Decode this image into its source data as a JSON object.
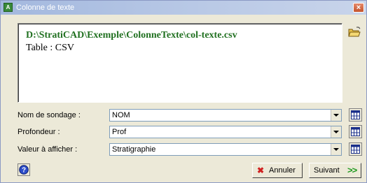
{
  "window": {
    "title": "Colonne de texte",
    "icon": "app-icon",
    "close_label": "×"
  },
  "file_box": {
    "path": "D:\\StratiCAD\\Exemple\\ColonneTexte\\col-texte.csv",
    "table": "Table : CSV",
    "path_color": "#207020"
  },
  "fields": [
    {
      "label": "Nom de sondage :",
      "value": "NOM"
    },
    {
      "label": "Profondeur :",
      "value": "Prof"
    },
    {
      "label": "Valeur à afficher :",
      "value": "Stratigraphie"
    }
  ],
  "buttons": {
    "cancel": "Annuler",
    "next": "Suivant",
    "next_icon": ">>",
    "cancel_icon": "✖"
  },
  "icons": {
    "open": "open-folder-icon",
    "grid": "table-grid-icon",
    "help": "help-icon"
  }
}
